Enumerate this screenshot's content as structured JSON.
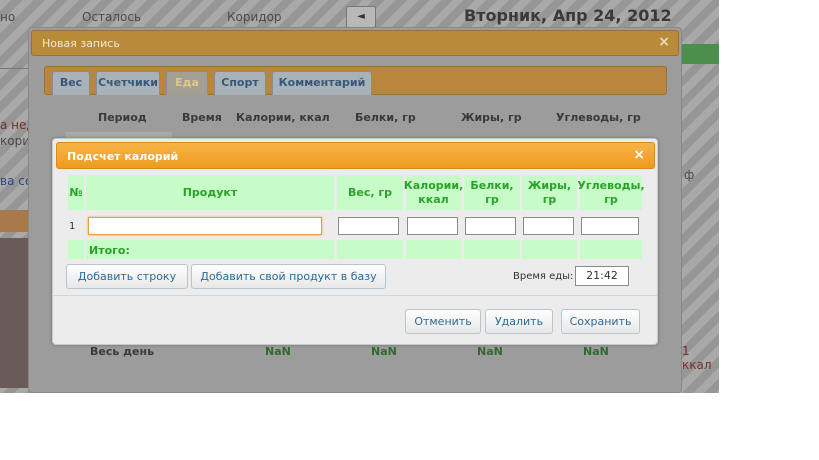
{
  "background": {
    "header_cols": [
      "но",
      "Осталось",
      "Коридор"
    ],
    "date_title": "Вторник, Апр 24, 2012",
    "prev_button": "◄",
    "left_fragments": [
      "а нед",
      "кори,",
      "ва се"
    ],
    "right_fragments": [
      "1 ккал",
      "ф"
    ]
  },
  "outer_dialog": {
    "title": "Новая запись",
    "tabs": [
      "Вес",
      "Счетчики",
      "Еда",
      "Спорт",
      "Комментарий"
    ],
    "active_tab": "Еда",
    "columns": [
      "Период",
      "Время",
      "Калории, ккал",
      "Белки, гр",
      "Жиры, гр",
      "Углеводы, гр"
    ],
    "footer_row": {
      "label": "Весь день",
      "values": [
        "NaN",
        "NaN",
        "NaN",
        "NaN"
      ]
    }
  },
  "calorie_dialog": {
    "title": "Подсчет калорий",
    "close_icon": "close-icon",
    "headers": {
      "num": "№",
      "product": "Продукт",
      "weight": "Вес, гр",
      "calories_line1": "Калории,",
      "calories_line2": "ккал",
      "protein": "Белки, гр",
      "fat": "Жиры, гр",
      "carbs_line1": "Углеводы,",
      "carbs_line2": "гр"
    },
    "rows": [
      {
        "num": "1",
        "product": "",
        "weight": "",
        "calories": "",
        "protein": "",
        "fat": "",
        "carbs": ""
      }
    ],
    "total_label": "Итого:",
    "buttons": {
      "add_row": "Добавить строку",
      "add_product": "Добавить свой продукт в базу",
      "cancel": "Отменить",
      "delete": "Удалить",
      "save": "Сохранить"
    },
    "meal_time_label": "Время еды:",
    "meal_time_value": "21:42"
  },
  "colors": {
    "dialog_title_orange": "#ef9a20",
    "header_green_bg": "#c7fbc7",
    "header_green_text": "#2aa32a",
    "button_text_blue": "#2c6a96"
  }
}
